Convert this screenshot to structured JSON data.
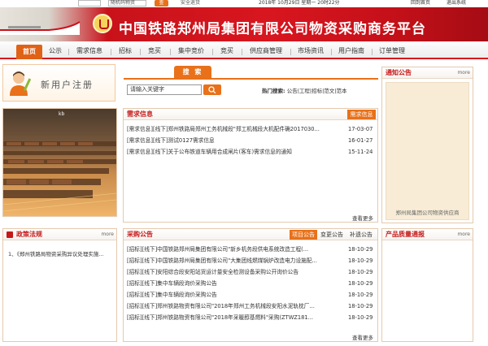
{
  "topbar": {
    "search_placeholder": "随机码物资",
    "go_label": "查",
    "security": "安全退货",
    "date_text": "2018年 10月29日  星期一  20时22分",
    "back_home": "回到首页",
    "logout": "退出系统"
  },
  "banner": {
    "title": "中国铁路郑州局集团有限公司物资采购商务平台"
  },
  "nav": {
    "items": [
      "首页",
      "公示",
      "需求信息",
      "招标",
      "竞买",
      "集中竞价",
      "竞买",
      "供应商管理",
      "市场资讯",
      "用户指南",
      "订单管理"
    ]
  },
  "register": {
    "label": "新用户注册"
  },
  "search": {
    "tab": "搜 索",
    "placeholder": "请输入关键字",
    "hot_label": "热门搜索:",
    "hot_items": "公告|工程|招标|范文|范本"
  },
  "notice": {
    "title": "通知公告",
    "more": "more",
    "caption": "郑州局集团公司物资供应商"
  },
  "photo": {
    "caption": "kb"
  },
  "demand": {
    "title": "需求信息",
    "tab": "需求信息",
    "rows": [
      {
        "text": "[需求信息][线下]郑州铁路局郑州工务机械段\"郑工机械段大机配件确2017030...",
        "date": "17-03-07"
      },
      {
        "text": "[需求信息][线下]测试0127需求信息",
        "date": "16-01-27"
      },
      {
        "text": "[需求信息][线下]关于公布铁道车辆用合成闸片(客车)需求信息的通知",
        "date": "15-11-24"
      }
    ],
    "more": "查看更多"
  },
  "policy": {
    "title": "政策法规",
    "more": "more",
    "items": [
      "1、《郑州铁路局物资采购异议处理实施..."
    ]
  },
  "purchase": {
    "title": "采购公告",
    "tabs": [
      "项目公告",
      "变更公告",
      "补遗公告"
    ],
    "rows": [
      {
        "text": "[招标][线下]中国铁路郑州局集团有限公司\"新乡机务段供电系统改造工程(...",
        "date": "18-10-29"
      },
      {
        "text": "[招标][线下]中国铁路郑州局集团有限公司\"大集团线燃煤锅炉改造电力设施配...",
        "date": "18-10-29"
      },
      {
        "text": "[招标][线下]安阳综合段安阳站货运计量安全检测设备采购公开询价公告",
        "date": "18-10-29"
      },
      {
        "text": "[招标][线下]集中车辆段询价采购公告",
        "date": "18-10-29"
      },
      {
        "text": "[招标][线下]集中车辆段询价采购公告",
        "date": "18-10-29"
      },
      {
        "text": "[招标][线下]郑州铁路物资有限公司\"2018年郑州工务机械段安阳水泥轨枕厂...",
        "date": "18-10-29"
      },
      {
        "text": "[招标][线下]郑州铁路物资有限公司\"2018年采暖醇基燃料\"采购(ZTWZ181...",
        "date": "18-10-29"
      }
    ],
    "more": "查看更多"
  },
  "quality": {
    "title": "产品质量通报",
    "more": "more"
  },
  "colors": {
    "brand_red": "#d7141c",
    "accent_orange": "#e8711a"
  }
}
